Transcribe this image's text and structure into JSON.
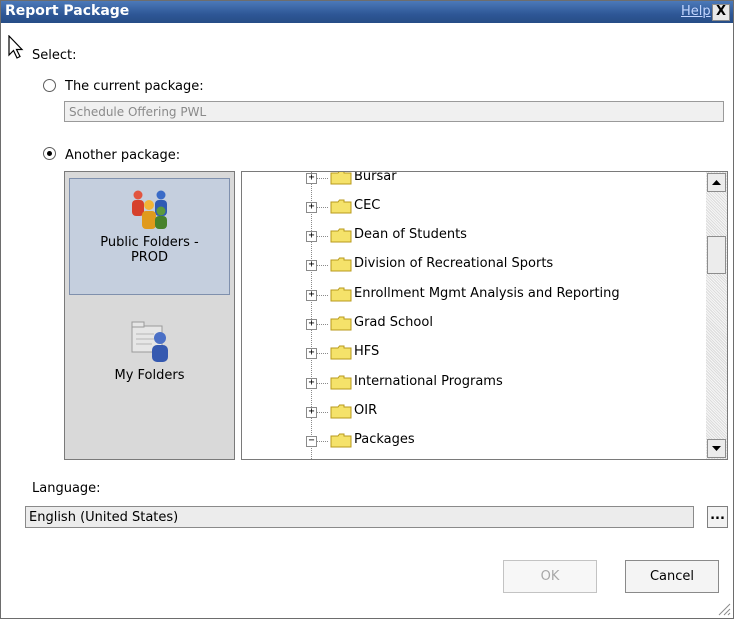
{
  "dialog": {
    "title": "Report Package",
    "help_label": "Help",
    "close_glyph": "X"
  },
  "select_label": "Select:",
  "current_package": {
    "label": "The current package:",
    "value": "Schedule Offering PWL",
    "selected": false
  },
  "another_package": {
    "label": "Another package:",
    "selected": true
  },
  "locations": [
    {
      "label_line1": "Public Folders -",
      "label_line2": "PROD",
      "icon": "public-folders-icon",
      "selected": true
    },
    {
      "label_line1": "My Folders",
      "label_line2": "",
      "icon": "my-folders-icon",
      "selected": false
    }
  ],
  "tree": {
    "items": [
      {
        "label": "Bursar",
        "expander": "+"
      },
      {
        "label": "CEC",
        "expander": "+"
      },
      {
        "label": "Dean of Students",
        "expander": "+"
      },
      {
        "label": "Division of Recreational Sports",
        "expander": "+"
      },
      {
        "label": "Enrollment Mgmt Analysis and Reporting",
        "expander": "+"
      },
      {
        "label": "Grad School",
        "expander": "+"
      },
      {
        "label": "HFS",
        "expander": "+"
      },
      {
        "label": "International Programs",
        "expander": "+"
      },
      {
        "label": "OIR",
        "expander": "+"
      },
      {
        "label": "Packages",
        "expander": "−"
      }
    ],
    "folder_color": "#f5e26a",
    "scroll_position": 0.25
  },
  "language": {
    "label": "Language:",
    "value": "English (United States)",
    "browse_label": "..."
  },
  "buttons": {
    "ok": "OK",
    "cancel": "Cancel"
  },
  "colors": {
    "titlebar": "#2e5796",
    "selection": "#c5cfde"
  }
}
